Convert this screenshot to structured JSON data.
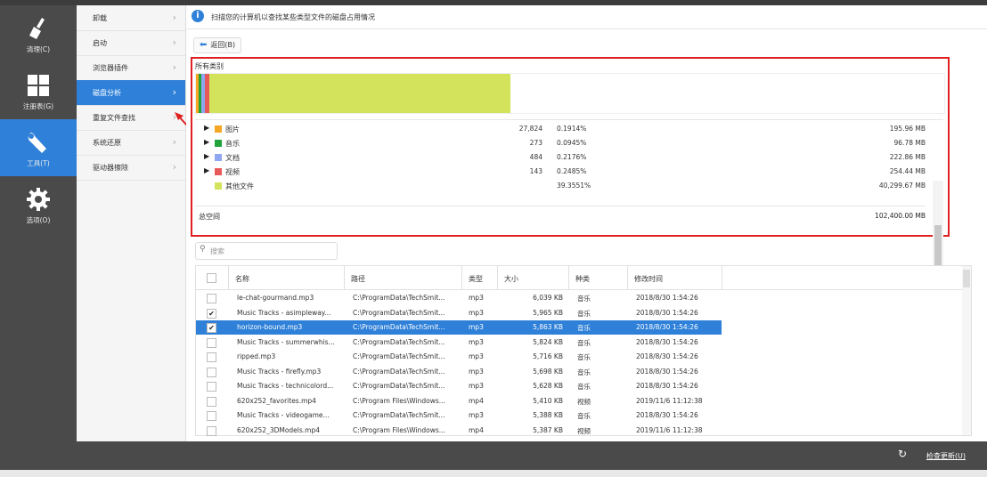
{
  "leftnav": [
    {
      "label": "清理(C)",
      "icon": "broom-icon"
    },
    {
      "label": "注册表(G)",
      "icon": "grid-icon"
    },
    {
      "label": "工具(T)",
      "icon": "wrench-icon"
    },
    {
      "label": "选项(O)",
      "icon": "gear-icon"
    }
  ],
  "subnav": [
    {
      "label": "卸载"
    },
    {
      "label": "启动"
    },
    {
      "label": "浏览器插件"
    },
    {
      "label": "磁盘分析"
    },
    {
      "label": "重复文件查找"
    },
    {
      "label": "系统还原"
    },
    {
      "label": "驱动器擦除"
    }
  ],
  "info": {
    "text": "扫描您的计算机以查找某些类型文件的磁盘占用情况"
  },
  "back": {
    "label": "返回(B)"
  },
  "categories": {
    "title": "所有类别",
    "rows": [
      {
        "name": "图片",
        "count": "27,824",
        "percent": "0.1914%",
        "size": "195.96 MB",
        "color": "#f5a623"
      },
      {
        "name": "音乐",
        "count": "273",
        "percent": "0.0945%",
        "size": "96.78 MB",
        "color": "#1fa33a"
      },
      {
        "name": "文档",
        "count": "484",
        "percent": "0.2176%",
        "size": "222.86 MB",
        "color": "#8fa6f0"
      },
      {
        "name": "视频",
        "count": "143",
        "percent": "0.2485%",
        "size": "254.44 MB",
        "color": "#e85a5a"
      },
      {
        "name": "其他文件",
        "count": "",
        "percent": "39.3551%",
        "size": "40,299.67 MB",
        "color": "#d4e35c"
      }
    ],
    "total_label": "总空间",
    "total_size": "102,400.00 MB"
  },
  "search": {
    "placeholder": "搜索"
  },
  "table": {
    "headers": [
      "名称",
      "路径",
      "类型",
      "大小",
      "种类",
      "修改时间"
    ],
    "rows": [
      {
        "checked": "",
        "name": "le-chat-gourmand.mp3",
        "path": "C:\\ProgramData\\TechSmit...",
        "type": "mp3",
        "size": "6,039 KB",
        "kind": "音乐",
        "mtime": "2018/8/30 1:54:26"
      },
      {
        "checked": "✔",
        "name": "Music Tracks - asimpleway...",
        "path": "C:\\ProgramData\\TechSmit...",
        "type": "mp3",
        "size": "5,965 KB",
        "kind": "音乐",
        "mtime": "2018/8/30 1:54:26"
      },
      {
        "checked": "✔",
        "name": "horizon-bound.mp3",
        "path": "C:\\ProgramData\\TechSmit...",
        "type": "mp3",
        "size": "5,863 KB",
        "kind": "音乐",
        "mtime": "2018/8/30 1:54:26"
      },
      {
        "checked": "",
        "name": "Music Tracks - summerwhis...",
        "path": "C:\\ProgramData\\TechSmit...",
        "type": "mp3",
        "size": "5,824 KB",
        "kind": "音乐",
        "mtime": "2018/8/30 1:54:26"
      },
      {
        "checked": "",
        "name": "ripped.mp3",
        "path": "C:\\ProgramData\\TechSmit...",
        "type": "mp3",
        "size": "5,716 KB",
        "kind": "音乐",
        "mtime": "2018/8/30 1:54:26"
      },
      {
        "checked": "",
        "name": "Music Tracks - firefly.mp3",
        "path": "C:\\ProgramData\\TechSmit...",
        "type": "mp3",
        "size": "5,698 KB",
        "kind": "音乐",
        "mtime": "2018/8/30 1:54:26"
      },
      {
        "checked": "",
        "name": "Music Tracks - technicolord...",
        "path": "C:\\ProgramData\\TechSmit...",
        "type": "mp3",
        "size": "5,628 KB",
        "kind": "音乐",
        "mtime": "2018/8/30 1:54:26"
      },
      {
        "checked": "",
        "name": "620x252_favorites.mp4",
        "path": "C:\\Program Files\\Windows...",
        "type": "mp4",
        "size": "5,410 KB",
        "kind": "视频",
        "mtime": "2019/11/6 11:12:38"
      },
      {
        "checked": "",
        "name": "Music Tracks - videogame...",
        "path": "C:\\ProgramData\\TechSmit...",
        "type": "mp3",
        "size": "5,388 KB",
        "kind": "音乐",
        "mtime": "2018/8/30 1:54:26"
      },
      {
        "checked": "",
        "name": "620x252_3DModels.mp4",
        "path": "C:\\Program Files\\Windows...",
        "type": "mp4",
        "size": "5,387 KB",
        "kind": "视频",
        "mtime": "2019/11/6 11:12:38"
      }
    ]
  },
  "bottom": {
    "update_label": "检查更新(U)"
  },
  "colors": {
    "accent": "#2f80d8",
    "highlight_frame": "#e02020"
  }
}
